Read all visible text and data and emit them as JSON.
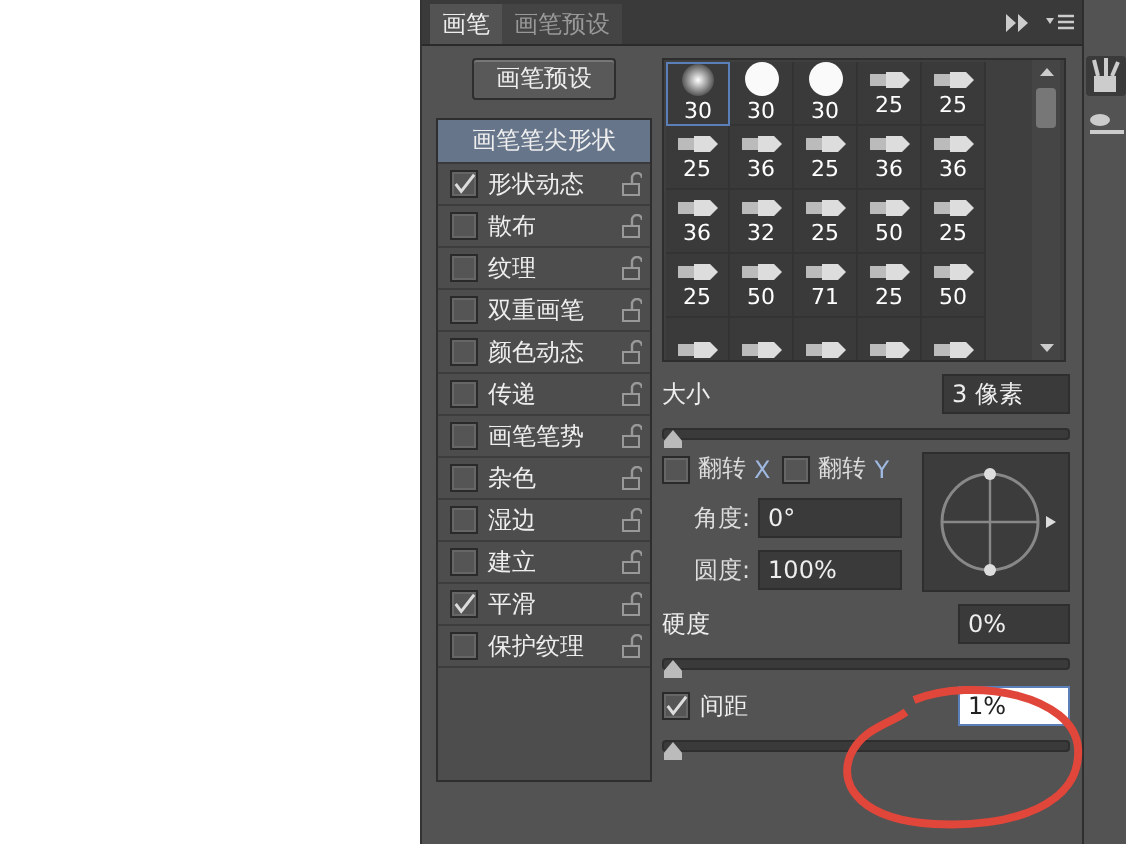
{
  "tabs": [
    {
      "label": "画笔",
      "selected": true
    },
    {
      "label": "画笔预设",
      "selected": false
    }
  ],
  "preset_button": "画笔预设",
  "sidebar": {
    "header": {
      "label": "画笔笔尖形状",
      "selected": true
    },
    "items": [
      {
        "label": "形状动态",
        "checked": true
      },
      {
        "label": "散布",
        "checked": false
      },
      {
        "label": "纹理",
        "checked": false
      },
      {
        "label": "双重画笔",
        "checked": false
      },
      {
        "label": "颜色动态",
        "checked": false
      },
      {
        "label": "传递",
        "checked": false
      },
      {
        "label": "画笔笔势",
        "checked": false
      },
      {
        "label": "杂色",
        "checked": false
      },
      {
        "label": "湿边",
        "checked": false
      },
      {
        "label": "建立",
        "checked": false
      },
      {
        "label": "平滑",
        "checked": true
      },
      {
        "label": "保护纹理",
        "checked": false
      }
    ]
  },
  "brush_tips": [
    {
      "kind": "soft",
      "size": "30",
      "selected": true
    },
    {
      "kind": "hard",
      "size": "30",
      "selected": false
    },
    {
      "kind": "hard",
      "size": "30",
      "selected": false
    },
    {
      "kind": "tool",
      "size": "25",
      "selected": false
    },
    {
      "kind": "tool",
      "size": "25",
      "selected": false
    },
    {
      "kind": "tool",
      "size": "25",
      "selected": false
    },
    {
      "kind": "tool",
      "size": "36",
      "selected": false
    },
    {
      "kind": "tool",
      "size": "25",
      "selected": false
    },
    {
      "kind": "tool",
      "size": "36",
      "selected": false
    },
    {
      "kind": "tool",
      "size": "36",
      "selected": false
    },
    {
      "kind": "tool",
      "size": "36",
      "selected": false
    },
    {
      "kind": "tool",
      "size": "32",
      "selected": false
    },
    {
      "kind": "tool",
      "size": "25",
      "selected": false
    },
    {
      "kind": "tool",
      "size": "50",
      "selected": false
    },
    {
      "kind": "tool",
      "size": "25",
      "selected": false
    },
    {
      "kind": "tool",
      "size": "25",
      "selected": false
    },
    {
      "kind": "tool",
      "size": "50",
      "selected": false
    },
    {
      "kind": "tool",
      "size": "71",
      "selected": false
    },
    {
      "kind": "tool",
      "size": "25",
      "selected": false
    },
    {
      "kind": "tool",
      "size": "50",
      "selected": false
    },
    {
      "kind": "tool",
      "selected": false
    },
    {
      "kind": "tool",
      "selected": false
    },
    {
      "kind": "tool",
      "selected": false
    },
    {
      "kind": "tool",
      "selected": false
    },
    {
      "kind": "tool",
      "selected": false
    }
  ],
  "size": {
    "label": "大小",
    "value": "3 像素",
    "level": 0.0
  },
  "flip": [
    {
      "label": "翻转",
      "axis": "X",
      "checked": false
    },
    {
      "label": "翻转",
      "axis": "Y",
      "checked": false
    }
  ],
  "angle": {
    "label": "角度:",
    "value": "0°"
  },
  "roundness": {
    "label": "圆度:",
    "value": "100%"
  },
  "hardness": {
    "label": "硬度",
    "value": "0%",
    "level": 0.0
  },
  "spacing": {
    "label": "间距",
    "value": "1%",
    "checked": true,
    "level": 0.0
  }
}
